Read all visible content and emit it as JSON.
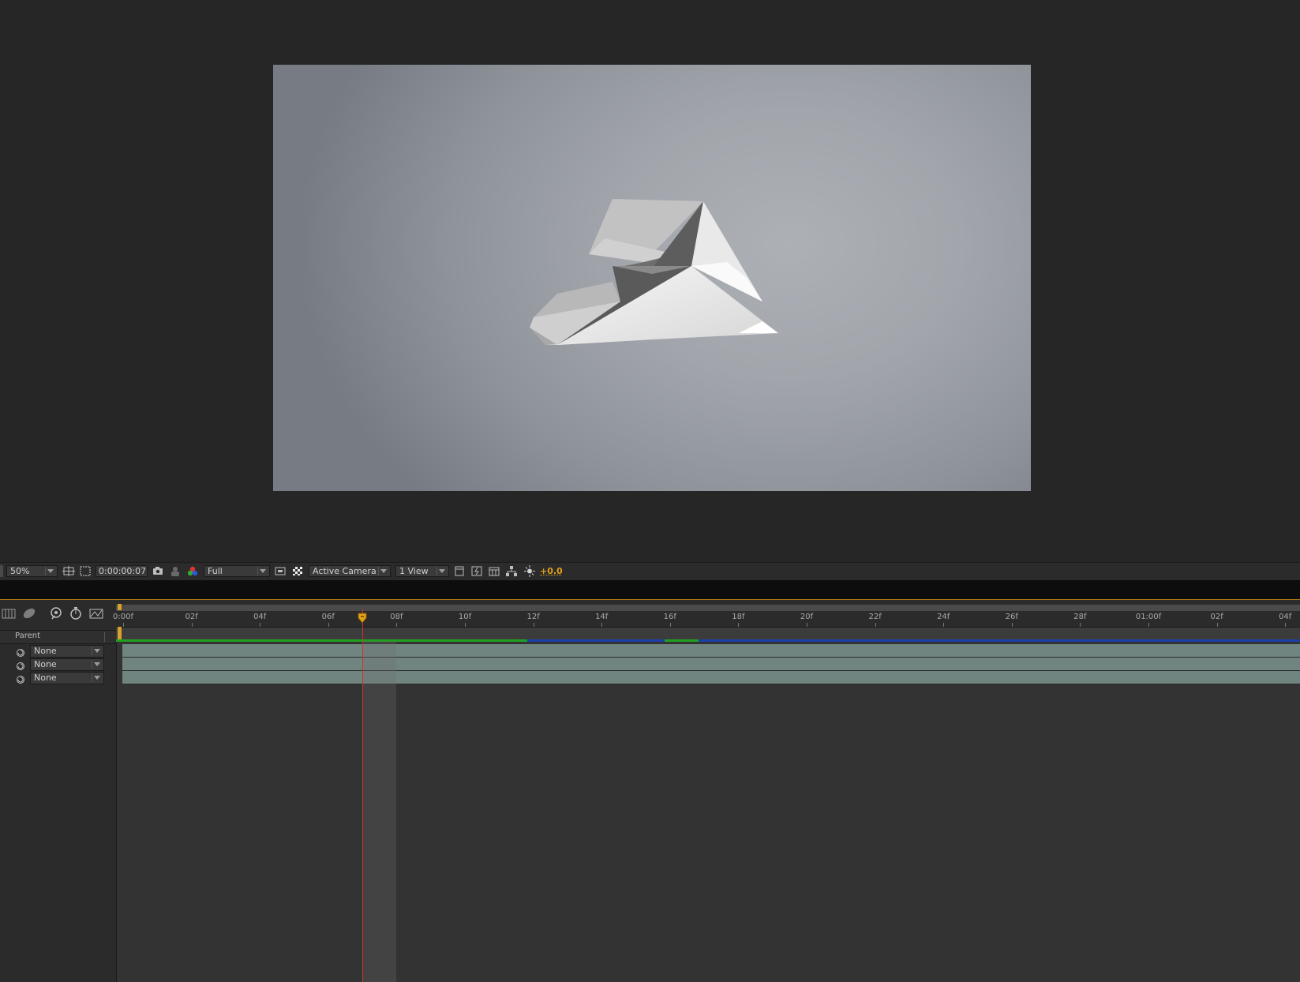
{
  "viewer": {
    "toolbar": {
      "zoom": "50%",
      "timecode": "0:00:00:07",
      "resolution": "Full",
      "view_camera": "Active Camera",
      "view_layout": "1 View",
      "exposure": "+0.0"
    }
  },
  "timeline": {
    "parent_column_label": "Parent",
    "layers": [
      {
        "parent": "None"
      },
      {
        "parent": "None"
      },
      {
        "parent": "None"
      }
    ],
    "ruler_ticks": [
      "0:00f",
      "02f",
      "04f",
      "06f",
      "08f",
      "10f",
      "12f",
      "14f",
      "16f",
      "18f",
      "20f",
      "22f",
      "24f",
      "26f",
      "28f",
      "01:00f",
      "02f",
      "04f"
    ],
    "current_frame": 7,
    "colors": {
      "playhead": "#d2322a",
      "playhead_head": "#e2a21c",
      "cache_green": "#1fa11f",
      "cache_blue": "#1b3fa8",
      "layer_bar": "#708480",
      "exposure_text": "#e0a01a"
    }
  }
}
